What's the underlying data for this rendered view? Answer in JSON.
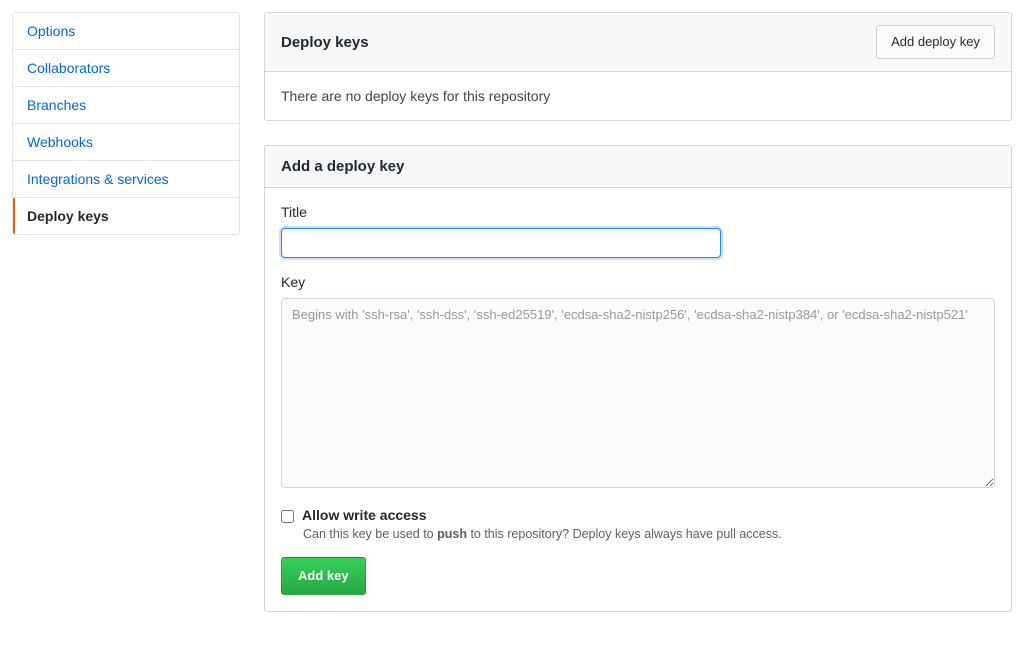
{
  "sidebar": {
    "items": [
      {
        "label": "Options",
        "selected": false
      },
      {
        "label": "Collaborators",
        "selected": false
      },
      {
        "label": "Branches",
        "selected": false
      },
      {
        "label": "Webhooks",
        "selected": false
      },
      {
        "label": "Integrations & services",
        "selected": false
      },
      {
        "label": "Deploy keys",
        "selected": true
      }
    ]
  },
  "deploy_keys_panel": {
    "title": "Deploy keys",
    "add_button": "Add deploy key",
    "empty_message": "There are no deploy keys for this repository"
  },
  "add_key_panel": {
    "title": "Add a deploy key",
    "title_label": "Title",
    "title_value": "",
    "key_label": "Key",
    "key_placeholder": "Begins with 'ssh-rsa', 'ssh-dss', 'ssh-ed25519', 'ecdsa-sha2-nistp256', 'ecdsa-sha2-nistp384', or 'ecdsa-sha2-nistp521'",
    "key_value": "",
    "allow_write_label": "Allow write access",
    "allow_write_checked": false,
    "allow_write_hint_prefix": "Can this key be used to ",
    "allow_write_hint_strong": "push",
    "allow_write_hint_suffix": " to this repository? Deploy keys always have pull access.",
    "submit_label": "Add key"
  }
}
